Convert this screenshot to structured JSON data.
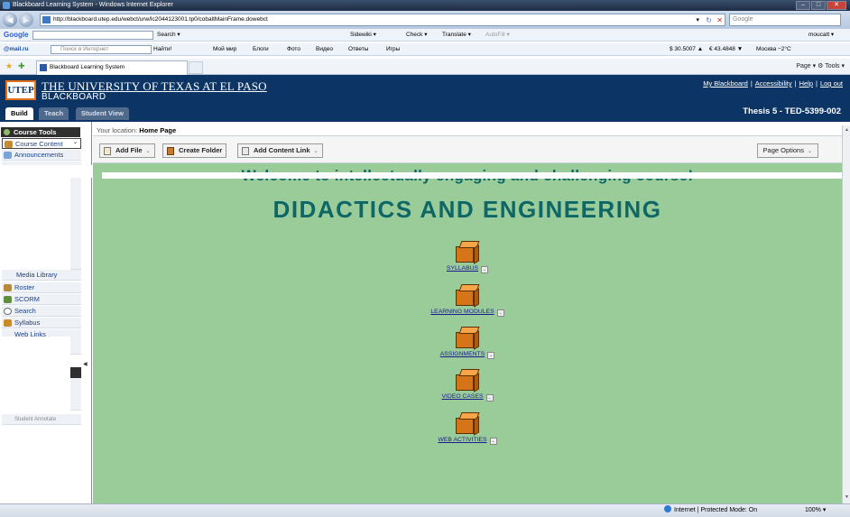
{
  "browser": {
    "title": "Blackboard Learning System - Windows Internet Explorer",
    "url": "http://blackboard.utep.edu/webct/urw/lc2044123001.tp0/cobaltMainFrame.dowebct",
    "search_placeholder": "Google",
    "tab_title": "Blackboard Learning System",
    "tab_tools": "Page ▾  ⚙ Tools ▾",
    "status_zone": "Internet | Protected Mode: On",
    "zoom": "100%"
  },
  "google_toolbar": {
    "logo": "Google",
    "search_btn": "Search ▾",
    "sidewiki": "Sidewiki ▾",
    "check": "Check ▾",
    "translate": "Translate ▾",
    "autofill": "AutoFill ▾",
    "user": "moucatt ▾"
  },
  "mailru_toolbar": {
    "logo": "@mail.ru",
    "search_placeholder": "Поиск в Интернет",
    "find_btn": "Найти!",
    "my_world": "Мой мир",
    "blogs": "Блоги",
    "photo": "Фото",
    "video": "Видео",
    "answers": "Ответы",
    "games": "Игры",
    "usd": "$ 30.5007 ▲",
    "eur": "€ 43.4848 ▼",
    "weather": "Москва  −2°C"
  },
  "header": {
    "university": "THE UNIVERSITY OF TEXAS AT EL PASO",
    "system": "BLACKBOARD",
    "logo_text": "UTEP",
    "links": [
      "My Blackboard",
      "Accessibility",
      "Help",
      "Log out"
    ],
    "course": "Thesis 5 - TED-5399-002",
    "tabs": [
      "Build",
      "Teach",
      "Student View"
    ]
  },
  "sidebar": {
    "heading": "Course Tools",
    "items_top": [
      "Course Content",
      "Announcements"
    ],
    "items_bottom": [
      "Roster",
      "SCORM",
      "Search",
      "Syllabus"
    ],
    "partial_media": "Media Library",
    "partial_weblinks": "Web Links",
    "partial_bottom": "Student Annotate"
  },
  "location": {
    "prefix": "Your location:",
    "page": "Home Page"
  },
  "actions": {
    "add_file": "Add File",
    "create_folder": "Create Folder",
    "add_content_link": "Add Content Link",
    "page_options": "Page Options"
  },
  "content": {
    "welcome": "Welcome to intellectually engaging and challenging course!",
    "course_title": "DIDACTICS AND ENGINEERING",
    "folders": [
      "SYLLABUS",
      "LEARNING MODULES",
      "ASSIGNMENTS",
      "VIDEO CASES",
      "WEB ACTIVITIES"
    ]
  },
  "colors": {
    "header_bg": "#0c3566",
    "content_bg": "#99cc99",
    "title_teal": "#0e6666",
    "folder_orange": "#d6741a"
  }
}
